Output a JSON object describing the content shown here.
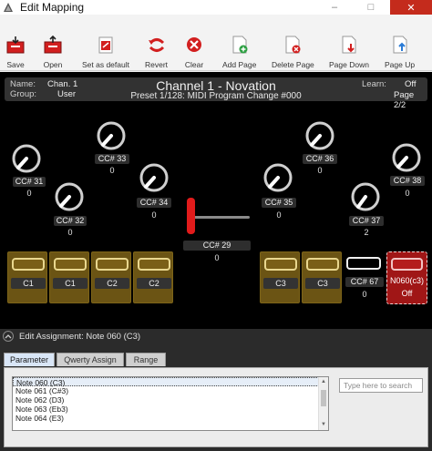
{
  "window": {
    "title": "Edit Mapping",
    "controls": {
      "minimize": "–",
      "maximize": "□",
      "close": "✕"
    }
  },
  "toolbar": {
    "buttons": [
      {
        "label": "Save",
        "icon": "save-icon"
      },
      {
        "label": "Open",
        "icon": "open-icon"
      },
      {
        "label": "Set as default",
        "icon": "set-default-icon"
      },
      {
        "label": "Revert",
        "icon": "revert-icon"
      },
      {
        "label": "Clear",
        "icon": "clear-icon"
      },
      {
        "label": "Add Page",
        "icon": "add-page-icon"
      },
      {
        "label": "Delete Page",
        "icon": "delete-page-icon"
      },
      {
        "label": "Page Down",
        "icon": "page-down-icon"
      },
      {
        "label": "Page Up",
        "icon": "page-up-icon"
      }
    ]
  },
  "header": {
    "name_label": "Name:",
    "name_value": "Chan. 1",
    "group_label": "Group:",
    "group_value": "User",
    "title": "Channel 1 - Novation",
    "subtitle": "Preset 1/128: MIDI Program Change #000",
    "learn_label": "Learn:",
    "learn_value": "Off",
    "page": "Page 2/2"
  },
  "knobs": [
    {
      "label": "CC# 31",
      "value": "0"
    },
    {
      "label": "CC# 32",
      "value": "0"
    },
    {
      "label": "CC# 33",
      "value": "0"
    },
    {
      "label": "CC# 34",
      "value": "0"
    },
    {
      "label": "CC# 35",
      "value": "0"
    },
    {
      "label": "CC# 36",
      "value": "0"
    },
    {
      "label": "CC# 37",
      "value": "2"
    },
    {
      "label": "CC# 38",
      "value": "0"
    }
  ],
  "fader": {
    "label": "CC# 29",
    "value": "0"
  },
  "pads": [
    {
      "label": "C1"
    },
    {
      "label": "C1"
    },
    {
      "label": "C2"
    },
    {
      "label": "C2"
    },
    {
      "label": "C3"
    },
    {
      "label": "C3"
    }
  ],
  "toggle_cc67": {
    "label": "CC# 67",
    "value": "0"
  },
  "note_button": {
    "label": "N060(c3)",
    "value": "Off"
  },
  "colors": {
    "pad_fill": "#6b5414",
    "active_note": "#b01818",
    "fader_handle": "#e11b1b",
    "background": "#000000"
  },
  "assignment": {
    "title": "Edit Assignment: Note 060 (C3)",
    "tabs": [
      "Parameter",
      "Qwerty Assign",
      "Range"
    ],
    "active_tab": "Parameter",
    "list": [
      "Note 060 (C3)",
      "Note 061 (C#3)",
      "Note 062 (D3)",
      "Note 063 (Eb3)",
      "Note 064 (E3)"
    ],
    "selected": "Note 060 (C3)",
    "search_placeholder": "Type here to search"
  }
}
